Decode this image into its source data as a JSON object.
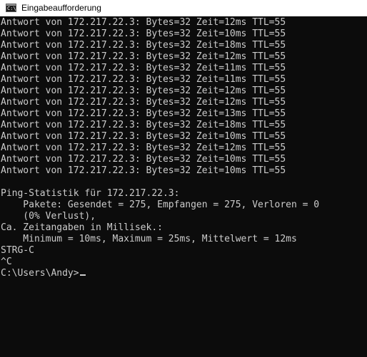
{
  "window": {
    "title": "Eingabeaufforderung",
    "icon_glyph": "C:\\"
  },
  "console": {
    "replies": [
      "Antwort von 172.217.22.3: Bytes=32 Zeit=12ms TTL=55",
      "Antwort von 172.217.22.3: Bytes=32 Zeit=10ms TTL=55",
      "Antwort von 172.217.22.3: Bytes=32 Zeit=18ms TTL=55",
      "Antwort von 172.217.22.3: Bytes=32 Zeit=12ms TTL=55",
      "Antwort von 172.217.22.3: Bytes=32 Zeit=11ms TTL=55",
      "Antwort von 172.217.22.3: Bytes=32 Zeit=11ms TTL=55",
      "Antwort von 172.217.22.3: Bytes=32 Zeit=12ms TTL=55",
      "Antwort von 172.217.22.3: Bytes=32 Zeit=12ms TTL=55",
      "Antwort von 172.217.22.3: Bytes=32 Zeit=13ms TTL=55",
      "Antwort von 172.217.22.3: Bytes=32 Zeit=18ms TTL=55",
      "Antwort von 172.217.22.3: Bytes=32 Zeit=10ms TTL=55",
      "Antwort von 172.217.22.3: Bytes=32 Zeit=12ms TTL=55",
      "Antwort von 172.217.22.3: Bytes=32 Zeit=10ms TTL=55",
      "Antwort von 172.217.22.3: Bytes=32 Zeit=10ms TTL=55"
    ],
    "statistics": {
      "header": "Ping-Statistik für 172.217.22.3:",
      "packets": "    Pakete: Gesendet = 275, Empfangen = 275, Verloren = 0",
      "loss": "    (0% Verlust),",
      "times_header": "Ca. Zeitangaben in Millisek.:",
      "times": "    Minimum = 10ms, Maximum = 25ms, Mittelwert = 12ms"
    },
    "interrupt": "STRG-C",
    "caret_c": "^C",
    "prompt": "C:\\Users\\Andy>"
  },
  "colors": {
    "background": "#0c0c0c",
    "text": "#cccccc",
    "titlebar": "#ffffff"
  }
}
